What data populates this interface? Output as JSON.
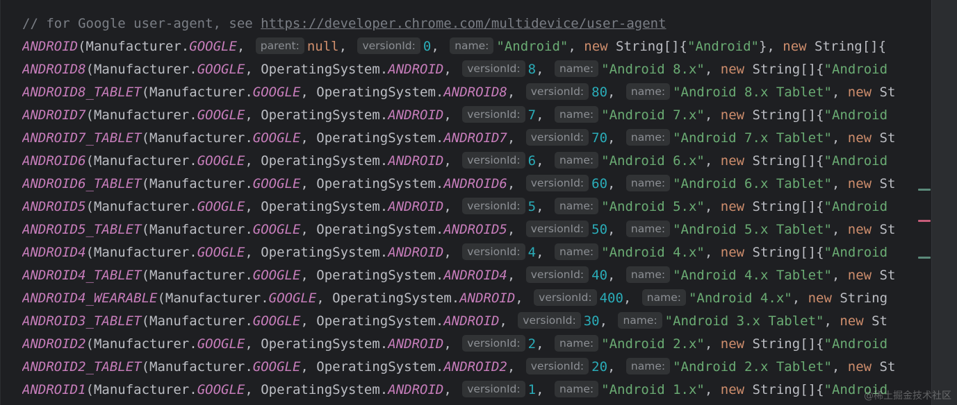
{
  "comment": {
    "prefix": "// for Google user-agent, see ",
    "url": "https://developer.chrome.com/multidevice/user-agent"
  },
  "common": {
    "open": "(",
    "manufacturer": "Manufacturer.",
    "google": "GOOGLE",
    "sep": ", ",
    "os": "OperatingSystem.",
    "kw_new": "new",
    "string_arr": " String[]{",
    "hint_parent": "parent:",
    "hint_versionId": "versionId:",
    "hint_name": "name:",
    "null_kw": "null"
  },
  "lines": [
    {
      "enum": "ANDROID",
      "parent": "null",
      "version": "0",
      "name": "\"Android\"",
      "tail": "new String[]{\"Android\"}, new String[]{"
    },
    {
      "enum": "ANDROID8",
      "parent": "ANDROID",
      "version": "8",
      "name": "\"Android 8.x\"",
      "tail": "new String[]{\"Android"
    },
    {
      "enum": "ANDROID8_TABLET",
      "parent": "ANDROID8",
      "version": "80",
      "name": "\"Android 8.x Tablet\"",
      "tail": "new St"
    },
    {
      "enum": "ANDROID7",
      "parent": "ANDROID",
      "version": "7",
      "name": "\"Android 7.x\"",
      "tail": "new String[]{\"Android"
    },
    {
      "enum": "ANDROID7_TABLET",
      "parent": "ANDROID7",
      "version": "70",
      "name": "\"Android 7.x Tablet\"",
      "tail": "new St"
    },
    {
      "enum": "ANDROID6",
      "parent": "ANDROID",
      "version": "6",
      "name": "\"Android 6.x\"",
      "tail": "new String[]{\"Android"
    },
    {
      "enum": "ANDROID6_TABLET",
      "parent": "ANDROID6",
      "version": "60",
      "name": "\"Android 6.x Tablet\"",
      "tail": "new St"
    },
    {
      "enum": "ANDROID5",
      "parent": "ANDROID",
      "version": "5",
      "name": "\"Android 5.x\"",
      "tail": "new String[]{\"Android"
    },
    {
      "enum": "ANDROID5_TABLET",
      "parent": "ANDROID5",
      "version": "50",
      "name": "\"Android 5.x Tablet\"",
      "tail": "new St"
    },
    {
      "enum": "ANDROID4",
      "parent": "ANDROID",
      "version": "4",
      "name": "\"Android 4.x\"",
      "tail": "new String[]{\"Android"
    },
    {
      "enum": "ANDROID4_TABLET",
      "parent": "ANDROID4",
      "version": "40",
      "name": "\"Android 4.x Tablet\"",
      "tail": "new St"
    },
    {
      "enum": "ANDROID4_WEARABLE",
      "parent": "ANDROID",
      "version": "400",
      "name": "\"Android 4.x\"",
      "tail": "new String"
    },
    {
      "enum": "ANDROID3_TABLET",
      "parent": "ANDROID",
      "version": "30",
      "name": "\"Android 3.x Tablet\"",
      "tail": "new St"
    },
    {
      "enum": "ANDROID2",
      "parent": "ANDROID",
      "version": "2",
      "name": "\"Android 2.x\"",
      "tail": "new String[]{\"Android"
    },
    {
      "enum": "ANDROID2_TABLET",
      "parent": "ANDROID2",
      "version": "20",
      "name": "\"Android 2.x Tablet\"",
      "tail": "new St"
    },
    {
      "enum": "ANDROID1",
      "parent": "ANDROID",
      "version": "1",
      "name": "\"Android 1.x\"",
      "tail": "new String[]{\"Android"
    }
  ],
  "watermark": "@稀土掘金技术社区",
  "colors": {
    "background": "#1e1f22",
    "enum": "#c77dbb",
    "keyword": "#cf8e6d",
    "string": "#6aab73",
    "number": "#2aacb8",
    "comment": "#7a7e85",
    "hint_bg": "#313335"
  }
}
